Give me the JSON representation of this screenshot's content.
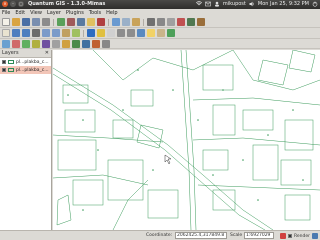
{
  "topbar": {
    "title": "Quantum GIS - 1.3.0-Mimas",
    "tray_user": "mikupost",
    "tray_time": "Mon Jan 25,  9:32 PM",
    "icons": [
      "wifi-icon",
      "mail-icon",
      "volume-icon",
      "power-icon"
    ]
  },
  "menubar": {
    "items": [
      "File",
      "Edit",
      "View",
      "Layer",
      "Plugins",
      "Tools",
      "Help"
    ]
  },
  "layers_panel": {
    "title": "Layers",
    "close_glyph": "✕",
    "items": [
      {
        "label": "pl...plakba_c...",
        "checked": true,
        "selected": false
      },
      {
        "label": "pl...plakba_c...",
        "checked": true,
        "selected": true
      }
    ]
  },
  "statusbar": {
    "coordinate_label": "Coordinate:",
    "coordinate_value": "2062425.4,317849.8",
    "scale_label": "Scale",
    "scale_value": "1:6927029",
    "render_label": "Render"
  },
  "colors": {
    "map_lines": "#3a9a5a",
    "selection": "#f3c6b8",
    "close_button": "#e05b2a"
  }
}
